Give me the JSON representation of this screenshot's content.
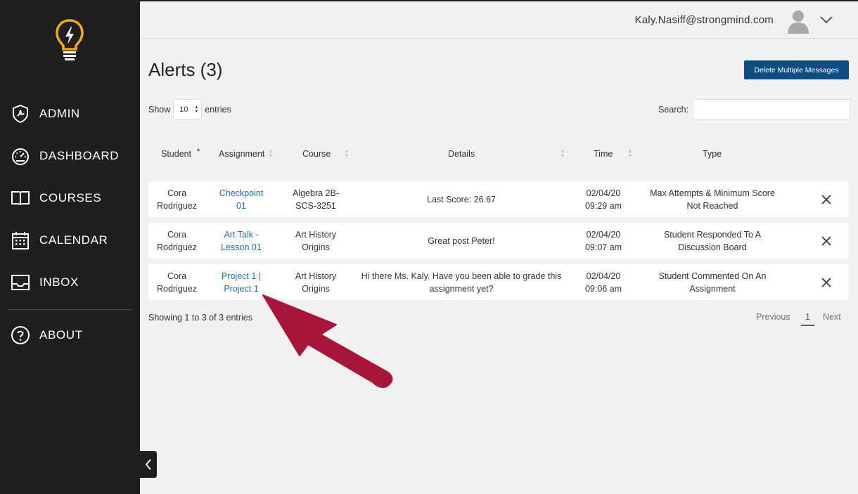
{
  "sidebar": {
    "items": [
      {
        "label": "ADMIN",
        "icon": "admin-shield-wrench-icon"
      },
      {
        "label": "DASHBOARD",
        "icon": "gauge-icon"
      },
      {
        "label": "COURSES",
        "icon": "open-book-icon"
      },
      {
        "label": "CALENDAR",
        "icon": "calendar-icon"
      },
      {
        "label": "INBOX",
        "icon": "inbox-tray-icon"
      },
      {
        "label": "ABOUT",
        "icon": "question-circle-icon"
      }
    ],
    "logo": "lightbulb-logo"
  },
  "header": {
    "user_email": "Kaly.Nasiff@strongmind.com",
    "avatar": "avatar-icon",
    "menu_icon": "chevron-down-icon"
  },
  "main": {
    "title": "Alerts (3)",
    "delete_multiple_label": "Delete Multiple Messages",
    "show_label": "Show",
    "entries_label": "entries",
    "entries_value": "10",
    "search_label": "Search:",
    "search_value": ""
  },
  "table": {
    "columns": [
      "Student",
      "Assignment",
      "Course",
      "Details",
      "Time",
      "Type"
    ],
    "rows": [
      {
        "student": [
          "Cora",
          "Rodriguez"
        ],
        "assignment": [
          "Checkpoint",
          "01"
        ],
        "course": [
          "Algebra 2B-",
          "SCS-3251"
        ],
        "details": [
          "Last Score: 26.67"
        ],
        "time": [
          "02/04/20",
          "09:29 am"
        ],
        "type": [
          "Max Attempts & Minimum Score",
          "Not Reached"
        ]
      },
      {
        "student": [
          "Cora",
          "Rodriguez"
        ],
        "assignment": [
          "Art Talk -",
          "Lesson 01"
        ],
        "course": [
          "Art History",
          "Origins"
        ],
        "details": [
          "Great post Peter!"
        ],
        "time": [
          "02/04/20",
          "09:07 am"
        ],
        "type": [
          "Student Responded To A",
          "Discussion Board"
        ]
      },
      {
        "student": [
          "Cora",
          "Rodriguez"
        ],
        "assignment": [
          "Project 1 |",
          "Project 1"
        ],
        "course": [
          "Art History",
          "Origins"
        ],
        "details": [
          "Hi there Ms. Kaly. Have you been able to grade this",
          "assignment yet?"
        ],
        "time": [
          "02/04/20",
          "09:06 am"
        ],
        "type": [
          "Student Commented On An",
          "Assignment"
        ]
      }
    ]
  },
  "footer": {
    "info": "Showing 1 to 3 of 3 entries",
    "previous": "Previous",
    "page": "1",
    "next": "Next"
  },
  "colors": {
    "sidebar_bg": "#1f1f22",
    "accent_button": "#0f4c81",
    "link": "#1f6fa8",
    "logo_orange": "#f5a623",
    "annotation_arrow": "#a8153a"
  }
}
